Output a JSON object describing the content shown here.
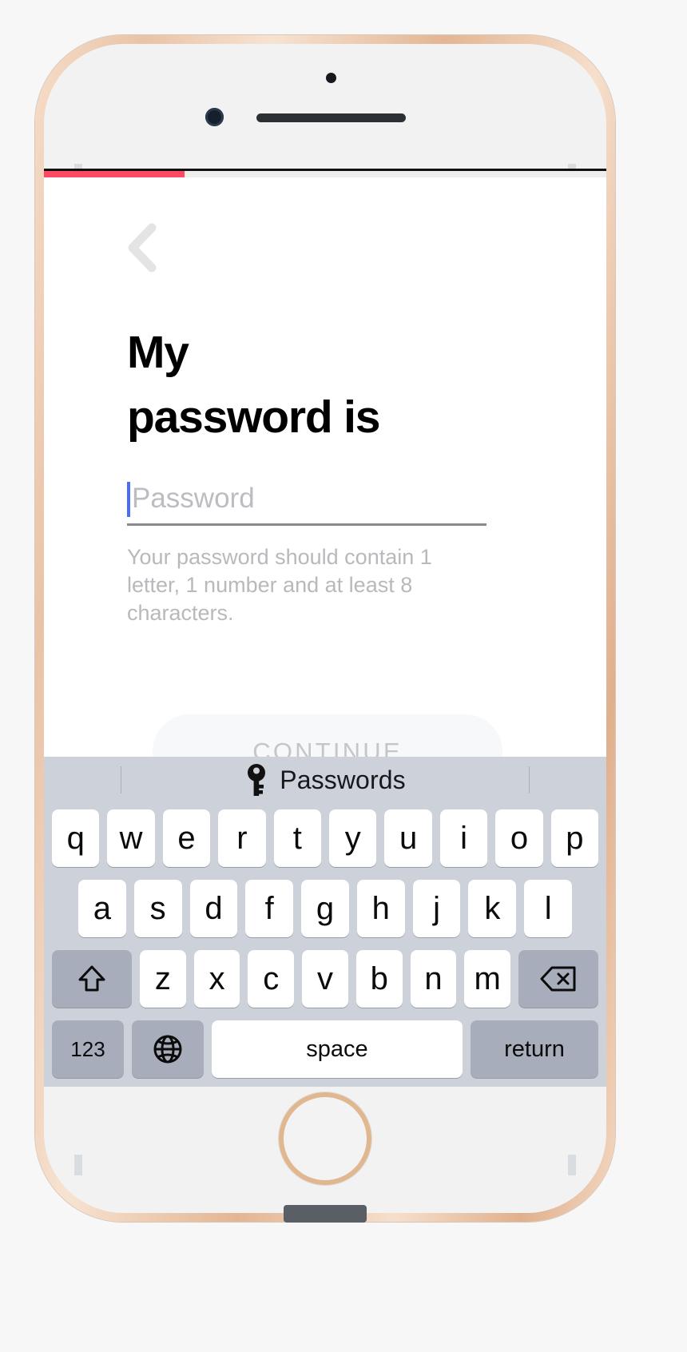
{
  "device": {
    "name": "iphone-gold",
    "frame_color": "#e9c3a6"
  },
  "screen": {
    "progress": {
      "percent": 25,
      "fill_color": "#fc4a63",
      "track_color": "#eeeeef"
    },
    "nav": {
      "back_icon": "chevron-left-icon"
    },
    "title": "My\npassword is",
    "password_field": {
      "value": "",
      "placeholder": "Password",
      "caret_color": "#4a6cf7",
      "underline_color": "#8b8b8f",
      "hint": "Your password should contain 1 letter, 1 number and at least 8 characters."
    },
    "continue_button": {
      "label": "CONTINUE",
      "enabled": false,
      "background": "#f7f8fa",
      "text_color": "#c6c6ca"
    }
  },
  "keyboard": {
    "suggestion_bar": {
      "icon": "key-icon",
      "label": "Passwords"
    },
    "rows": [
      [
        "q",
        "w",
        "e",
        "r",
        "t",
        "y",
        "u",
        "i",
        "o",
        "p"
      ],
      [
        "a",
        "s",
        "d",
        "f",
        "g",
        "h",
        "j",
        "k",
        "l"
      ],
      [
        "z",
        "x",
        "c",
        "v",
        "b",
        "n",
        "m"
      ]
    ],
    "shift_label": "shift-icon",
    "backspace_label": "backspace-icon",
    "numbers_key": "123",
    "globe_key": "globe-icon",
    "space_key": "space",
    "return_key": "return"
  }
}
